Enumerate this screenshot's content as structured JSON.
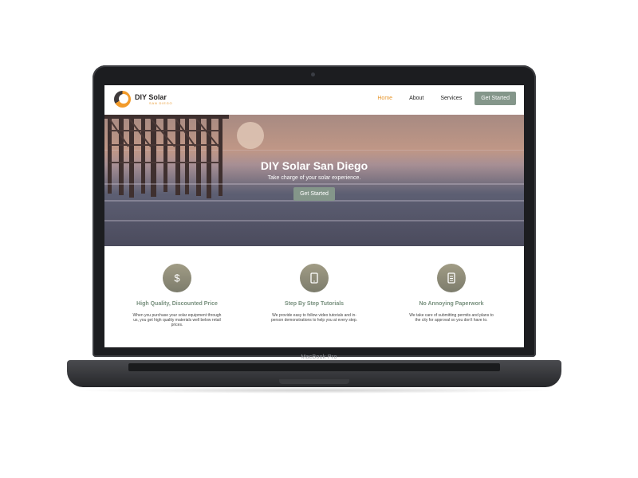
{
  "site": {
    "logo": {
      "title": "DIY Solar",
      "subtitle": "SAN DIEGO"
    },
    "nav": {
      "items": [
        "Home",
        "About",
        "Services"
      ],
      "cta": "Get Started"
    },
    "hero": {
      "title": "DIY Solar San Diego",
      "subtitle": "Take charge of your solar experience.",
      "cta": "Get Started"
    },
    "features": [
      {
        "icon": "dollar-icon",
        "title": "High Quality, Discounted Price",
        "body": "When you purchase your solar equipment through us, you get high quality materials well below retail prices."
      },
      {
        "icon": "tablet-icon",
        "title": "Step By Step Tutorials",
        "body": "We provide easy to follow video tutorials and in-person demonstrations to help you at every step."
      },
      {
        "icon": "document-icon",
        "title": "No Annoying Paperwork",
        "body": "We take care of submitting permits and plans to the city for approval so you don't have to."
      }
    ]
  },
  "device": {
    "label": "MacBook Pro"
  },
  "colors": {
    "accent": "#e7962c",
    "button": "#84968a",
    "feature_title": "#78907e"
  }
}
